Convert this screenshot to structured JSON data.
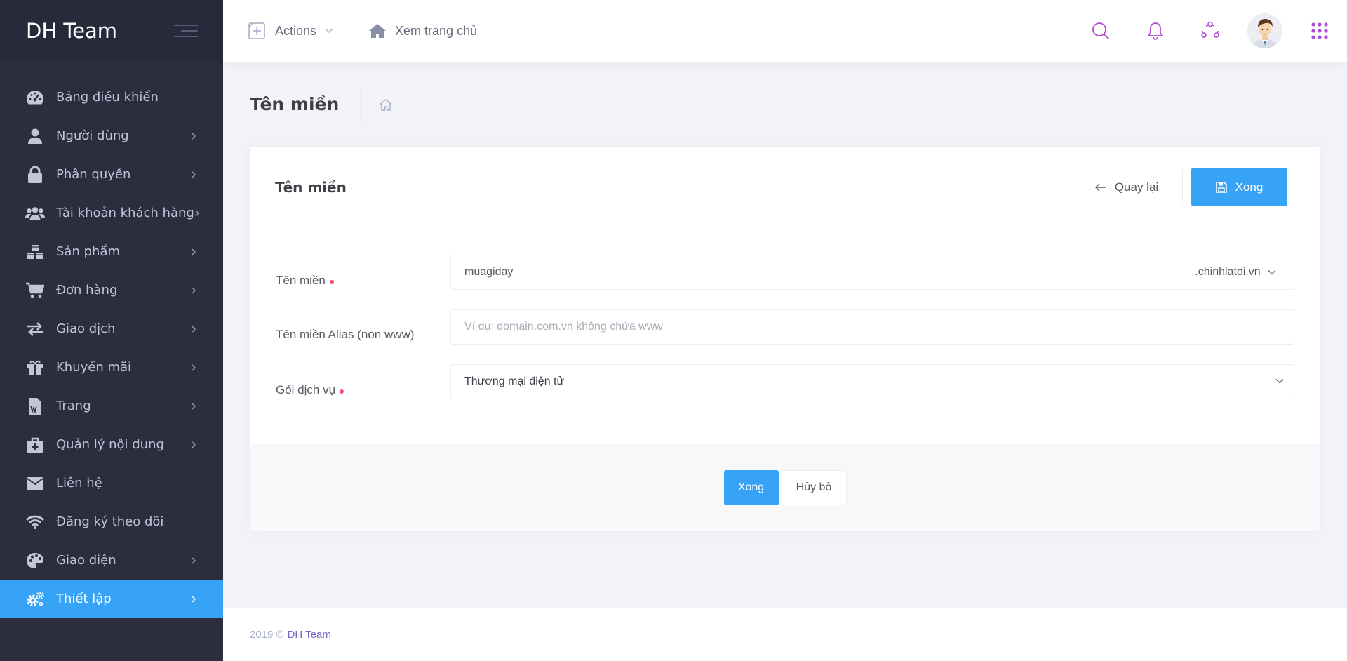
{
  "sidebar": {
    "brand": "DH Team",
    "items": [
      {
        "label": "Bảng điều khiển",
        "icon": "dashboard-icon",
        "has_arrow": false,
        "active": false
      },
      {
        "label": "Người dùng",
        "icon": "user-icon",
        "has_arrow": true,
        "active": false
      },
      {
        "label": "Phân quyền",
        "icon": "lock-icon",
        "has_arrow": true,
        "active": false
      },
      {
        "label": "Tài khoản khách hàng",
        "icon": "users-icon",
        "has_arrow": true,
        "active": false
      },
      {
        "label": "Sản phẩm",
        "icon": "cubes-icon",
        "has_arrow": true,
        "active": false
      },
      {
        "label": "Đơn hàng",
        "icon": "cart-icon",
        "has_arrow": true,
        "active": false
      },
      {
        "label": "Giao dịch",
        "icon": "exchange-icon",
        "has_arrow": true,
        "active": false
      },
      {
        "label": "Khuyến mãi",
        "icon": "gift-icon",
        "has_arrow": true,
        "active": false
      },
      {
        "label": "Trang",
        "icon": "file-word-icon",
        "has_arrow": true,
        "active": false
      },
      {
        "label": "Quản lý nội dung",
        "icon": "medkit-icon",
        "has_arrow": true,
        "active": false
      },
      {
        "label": "Liên hệ",
        "icon": "envelope-icon",
        "has_arrow": false,
        "active": false
      },
      {
        "label": "Đăng ký theo dõi",
        "icon": "wifi-icon",
        "has_arrow": false,
        "active": false
      },
      {
        "label": "Giao diện",
        "icon": "palette-icon",
        "has_arrow": true,
        "active": false
      },
      {
        "label": "Thiết lập",
        "icon": "cogs-icon",
        "has_arrow": true,
        "active": true
      }
    ]
  },
  "header": {
    "actions_label": "Actions",
    "home_link": "Xem trang chủ",
    "icons": [
      "search-icon",
      "bell-icon",
      "share-icon",
      "avatar",
      "apps-grid-icon"
    ]
  },
  "subheader": {
    "title": "Tên miền"
  },
  "portlet": {
    "title": "Tên miền",
    "back_label": "Quay lại",
    "save_label": "Xong"
  },
  "form": {
    "domain": {
      "label": "Tên miền",
      "required": true,
      "value": "muagiday",
      "suffix": ".chinhlatoi.vn"
    },
    "alias": {
      "label": "Tên miền Alias (non www)",
      "required": false,
      "placeholder": "Ví dụ: domain.com.vn không chứa www"
    },
    "package": {
      "label": "Gói dịch vụ",
      "required": true,
      "value": "Thương mại điện tử"
    }
  },
  "form_footer": {
    "save_label": "Xong",
    "cancel_label": "Hủy bỏ"
  },
  "footer": {
    "copyright": "2019 ©",
    "link": "DH Team"
  },
  "colors": {
    "sidebar_bg": "#2c2e3e",
    "brand_bg": "#282a3c",
    "accent": "#36a3f7",
    "required": "#f4516c",
    "header_icon": "#b04bd6",
    "footer_link": "#716aca"
  }
}
